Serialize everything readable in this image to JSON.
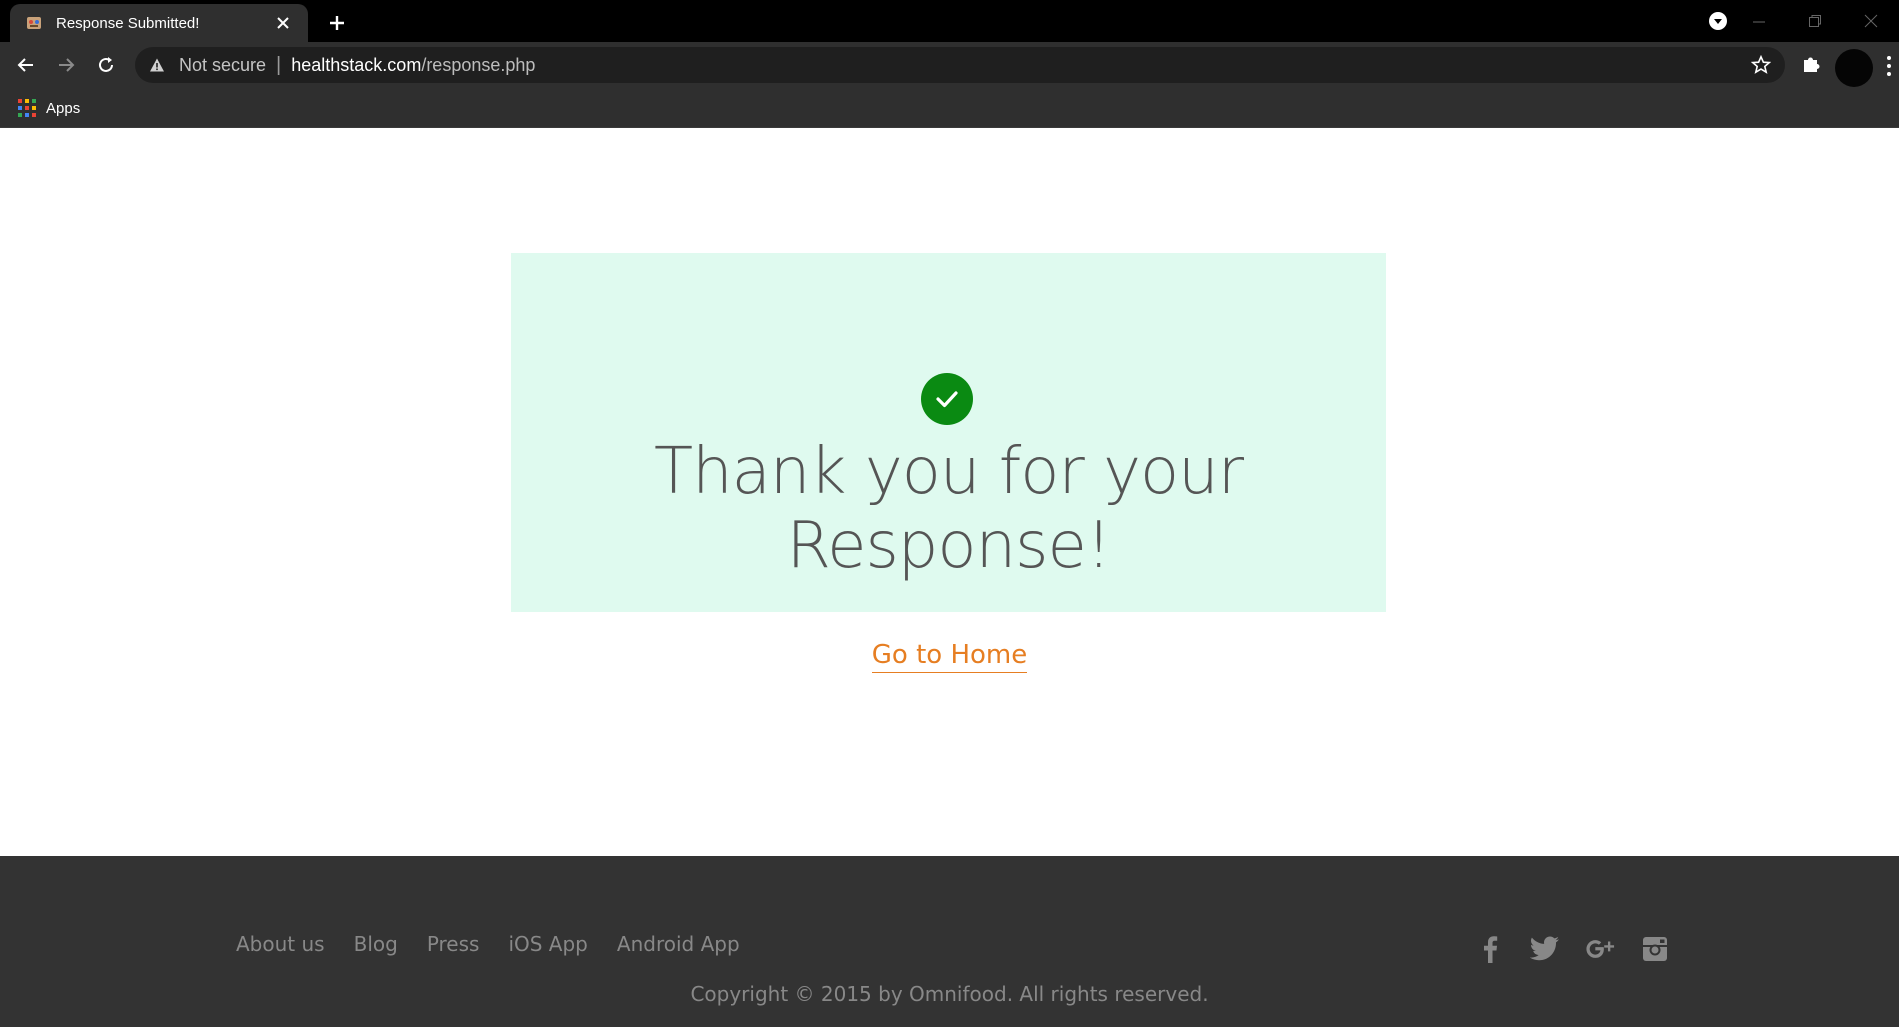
{
  "browser": {
    "tab_title": "Response Submitted!",
    "url_security": "Not secure",
    "url_host": "healthstack.com",
    "url_path": "/response.php",
    "bookmarks": [
      {
        "label": "Apps"
      }
    ]
  },
  "main": {
    "heading": "Thank you for your Response!",
    "home_link": "Go to Home"
  },
  "footer": {
    "nav": [
      "About us",
      "Blog",
      "Press",
      "iOS App",
      "Android App"
    ],
    "social_icons": [
      "facebook-icon",
      "twitter-icon",
      "google-plus-icon",
      "instagram-icon"
    ],
    "copyright": "Copyright © 2015 by Omnifood. All rights reserved."
  },
  "colors": {
    "card_bg": "#dffaef",
    "check_bg": "#0a8a12",
    "link": "#e67e22",
    "footer_bg": "#333333",
    "footer_text": "#888888"
  }
}
